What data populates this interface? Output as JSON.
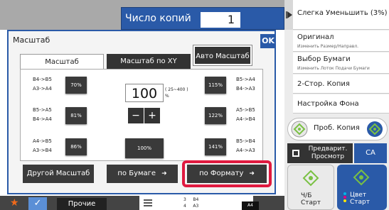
{
  "header": {
    "copies_label": "Число копий",
    "copies_value": "1"
  },
  "right_panel": {
    "items": [
      {
        "main": "Слегка Уменьшить (3%)",
        "sub": ""
      },
      {
        "main": "Оригинал",
        "sub": "Изменить Размер/Направл."
      },
      {
        "main": "Выбор Бумаги",
        "sub": "Изменить Лоток Подачи Бумаги"
      },
      {
        "main": "2-Стор. Копия",
        "sub": ""
      },
      {
        "main": "Настройка Фона",
        "sub": ""
      }
    ],
    "proof_copy_label": "Проб. Копия",
    "preview_label": "Предварит. Просмотр",
    "ca_label": "CA",
    "bw_start_label": "Ч/Б Старт",
    "color_start_label": "Цвет Старт"
  },
  "dialog": {
    "title": "Масштаб",
    "ok_label": "OK",
    "tabs": {
      "scale": "Масштаб",
      "scale_xy": "Масштаб по XY"
    },
    "auto_scale_label": "Авто Масштаб",
    "presets_left": [
      {
        "label_line1": "B4->B5",
        "label_line2": "A3->A4",
        "value": "70%"
      },
      {
        "label_line1": "B5->A5",
        "label_line2": "B4->A4",
        "value": "81%"
      },
      {
        "label_line1": "A4->B5",
        "label_line2": "A3->B4",
        "value": "86%"
      }
    ],
    "presets_right": [
      {
        "value": "115%",
        "label_line1": "B5->A4",
        "label_line2": "B4->A3"
      },
      {
        "value": "122%",
        "label_line1": "A5->B5",
        "label_line2": "A4->B4"
      },
      {
        "value": "141%",
        "label_line1": "B5->B4",
        "label_line2": "A4->A3"
      }
    ],
    "ratio_value": "100",
    "ratio_range": "( 25~400 )",
    "ratio_unit": "%",
    "minus_label": "−",
    "plus_label": "+",
    "btn_100_label": "100%",
    "bottom_buttons": {
      "other_scale": "Другой Масштаб",
      "by_paper": "по Бумаге",
      "by_format": "по Формату"
    }
  },
  "bottom_bar": {
    "more_label": "Прочие",
    "paper_rows": [
      {
        "tray": "3",
        "size": "B4"
      },
      {
        "tray": "4",
        "size": "A3"
      }
    ],
    "paper_badge": "A4"
  },
  "colors": {
    "accent_blue": "#2a5aa8",
    "highlight_red": "#e0193f",
    "star_orange": "#f06a1b",
    "green_icon": "#7ac143"
  }
}
